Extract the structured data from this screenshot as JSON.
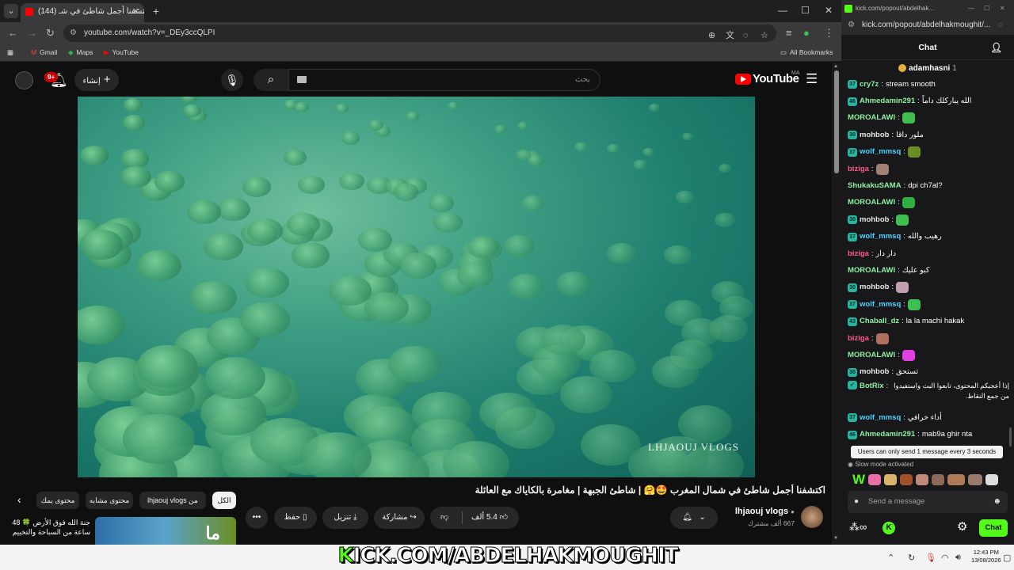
{
  "youtube_window": {
    "tab": {
      "title": "(144) اكتشفنا أجمل شاطئ في شـ"
    },
    "address": "youtube.com/watch?v=_DEy3ccQLPI",
    "bookmarks": [
      {
        "label": "Gmail",
        "icon": "gmail-icon"
      },
      {
        "label": "Maps",
        "icon": "maps-icon"
      },
      {
        "label": "YouTube",
        "icon": "youtube-icon"
      }
    ],
    "all_bookmarks": "All Bookmarks",
    "header": {
      "notifications_count": "9+",
      "create_label": "إنشاء",
      "search_placeholder": "بحث",
      "logo_text": "YouTube",
      "region": "MA"
    },
    "video": {
      "watermark": "LHJAOUJ VLOGS"
    },
    "chips": [
      "الكل",
      "من lhjaouj vlogs",
      "محتوى مشابه",
      "محتوى يمك"
    ],
    "title": "اكتشفنا أجمل شاطئ في شمال المغرب 🤩🤗 | شاطئ الجبهة | مغامرة بالكاياك مع العائلة 🤍",
    "channel": {
      "name": "lhjaouj vlogs",
      "subs": "667 ألف مشترك"
    },
    "actions": {
      "likes": "5.4 ألف",
      "share": "مشاركة",
      "download": "تنزيل",
      "save": "حفظ"
    },
    "suggestion": {
      "title": "جنة الله فوق الأرض 🍀 48 ساعة من السباحة والتخييم",
      "thumb_text": "ما"
    }
  },
  "kick_window": {
    "title_url": "kick.com/popout/abdelhak...",
    "address": "kick.com/popout/abdelhakmoughit/...",
    "chat_header": "Chat",
    "pinned_user": "adamhasni",
    "pinned_count": "1",
    "messages": [
      {
        "badge": "37",
        "user": "cry7z",
        "color": "#8ef0a0",
        "text": "stream smooth",
        "emote": ""
      },
      {
        "badge": "46",
        "user": "Ahmedamin291",
        "color": "#8ef0a0",
        "text": "الله يباركلك داماً",
        "emote": ""
      },
      {
        "badge": "",
        "user": "MOROALAWI",
        "color": "#8ef0a0",
        "text": "",
        "emote": "#3fbf4f"
      },
      {
        "badge": "30",
        "user": "mohbob",
        "color": "#e8e8e8",
        "text": "ملور داقا",
        "emote": ""
      },
      {
        "badge": "37",
        "user": "wolf_mmsq",
        "color": "#4ed3ff",
        "text": "",
        "emote": "#6b8e23"
      },
      {
        "badge": "",
        "user": "biziga",
        "color": "#ff5a8a",
        "text": "",
        "emote": "#a08070"
      },
      {
        "badge": "",
        "user": "ShukakuSAMA",
        "color": "#8ef0a0",
        "text": "dpi ch7al?",
        "emote": ""
      },
      {
        "badge": "",
        "user": "MOROALAWI",
        "color": "#8ef0a0",
        "text": "",
        "emote": "#2faf3f"
      },
      {
        "badge": "30",
        "user": "mohbob",
        "color": "#e8e8e8",
        "text": "",
        "emote": "#3fbf4f"
      },
      {
        "badge": "37",
        "user": "wolf_mmsq",
        "color": "#4ed3ff",
        "text": "رهيب والله",
        "emote": ""
      },
      {
        "badge": "",
        "user": "biziga",
        "color": "#ff5a8a",
        "text": "دار دار",
        "emote": ""
      },
      {
        "badge": "",
        "user": "MOROALAWI",
        "color": "#8ef0a0",
        "text": "كبو عليك",
        "emote": ""
      },
      {
        "badge": "30",
        "user": "mohbob",
        "color": "#e8e8e8",
        "text": "",
        "emote": "#c0a0b0"
      },
      {
        "badge": "37",
        "user": "wolf_mmsq",
        "color": "#4ed3ff",
        "text": "",
        "emote": "#3fbf4f"
      },
      {
        "badge": "43",
        "user": "Chaball_dz",
        "color": "#8ef0a0",
        "text": "la la machi hakak",
        "emote": ""
      },
      {
        "badge": "",
        "user": "biziga",
        "color": "#ff5a8a",
        "text": "",
        "emote": "#b07060"
      },
      {
        "badge": "",
        "user": "MOROALAWI",
        "color": "#8ef0a0",
        "text": "",
        "emote": "#e040e0"
      },
      {
        "badge": "30",
        "user": "mohbob",
        "color": "#e8e8e8",
        "text": "تستحق",
        "emote": ""
      },
      {
        "badge": "✓",
        "user": "BotRix",
        "color": "#8ef0a0",
        "text": "إذا أعجبكم المحتوى، تابعوا البث واستفيدوا من جمع النقاط.",
        "emote": "",
        "tall": true
      },
      {
        "badge": "37",
        "user": "wolf_mmsq",
        "color": "#4ed3ff",
        "text": "أداء خرافي",
        "emote": ""
      },
      {
        "badge": "46",
        "user": "Ahmedamin291",
        "color": "#8ef0a0",
        "text": "mab9a ghir nta",
        "emote": ""
      }
    ],
    "toast": "Users can only send 1 message every 3 seconds",
    "slow_mode": "Slow mode activated",
    "send_placeholder": "Send a message",
    "chat_button": "Chat"
  },
  "overlay": {
    "prefix": "K",
    "text": "ICK.COM/ABDELHAKMOUGHIT"
  },
  "taskbar": {
    "time": "12:43 PM",
    "date": "13/08/2026"
  },
  "colors": {
    "kick_green": "#53fc18",
    "youtube_red": "#ff0000"
  }
}
